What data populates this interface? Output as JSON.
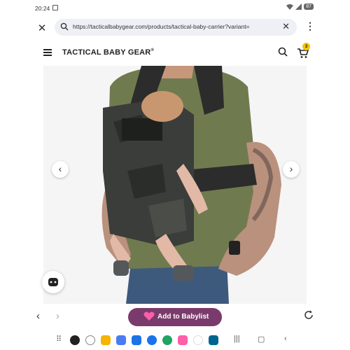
{
  "status": {
    "time": "20:24",
    "battery": "87"
  },
  "browser": {
    "url": "https://tacticalbabygear.com/products/tactical-baby-carrier?variant=",
    "close_icon": "close-icon",
    "clear_icon": "clear-icon",
    "menu_icon": "kebab-menu-icon"
  },
  "site": {
    "logo": "TACTICAL BABY GEAR",
    "logo_mark": "®",
    "cart_count": "3"
  },
  "gallery": {
    "prev_icon": "chevron-left-icon",
    "next_icon": "chevron-right-icon"
  },
  "bottom": {
    "babylist_label": "Add to Babylist",
    "babylist_color": "#7a3a6b"
  },
  "colors": {
    "cart_badge": "#f4c20d"
  }
}
